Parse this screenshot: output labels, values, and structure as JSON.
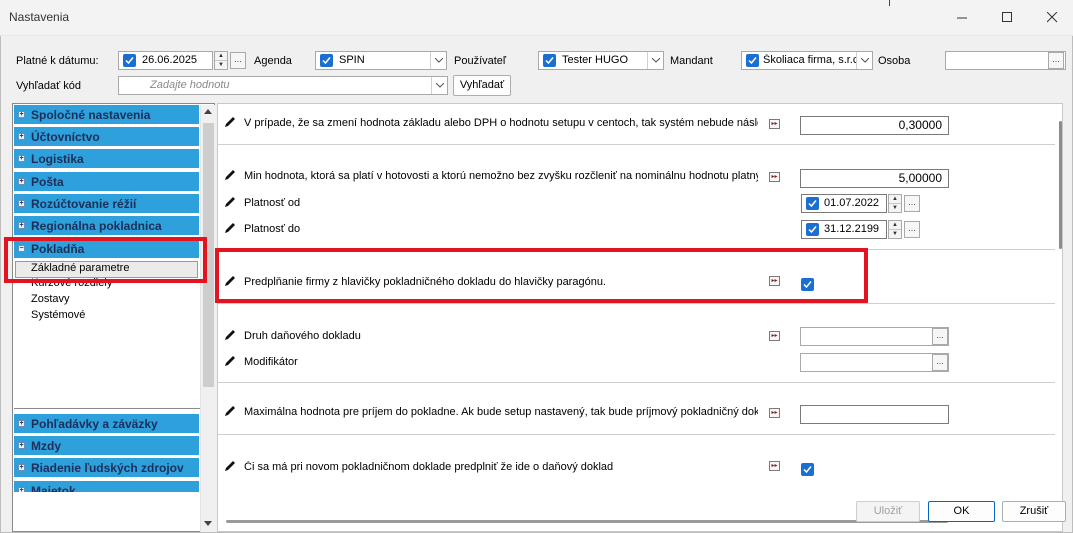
{
  "window": {
    "title": "Nastavenia"
  },
  "filters": {
    "date_label": "Platné k dátumu:",
    "date_value": "26.06.2025",
    "agenda_label": "Agenda",
    "agenda_value": "SPIN",
    "user_label": "Používateľ",
    "user_value": "Tester HUGO",
    "mandant_label": "Mandant",
    "mandant_value": "Školiaca firma, s.r.c",
    "osoba_label": "Osoba",
    "osoba_value": "",
    "search_label": "Vyhľadať kód",
    "search_placeholder": "Zadajte hodnotu",
    "search_button": "Vyhľadať",
    "ellipsis": "..."
  },
  "sidebar": {
    "categories_top": [
      "Spoločné nastavenia",
      "Účtovníctvo",
      "Logistika",
      "Pošta",
      "Rozúčtovanie réžií",
      "Regionálna pokladnica"
    ],
    "active_category": "Pokladňa",
    "subitems": [
      "Základné parametre",
      "Kurzové rozdiely",
      "Zostavy",
      "Systémové"
    ],
    "selected_subitem": "Základné parametre",
    "categories_bottom": [
      "Pohľadávky a záväzky",
      "Mzdy",
      "Riadenie ľudských zdrojov",
      "Majetok"
    ]
  },
  "settings": {
    "s1_text": "V prípade, že sa zmení hodnota základu alebo DPH o hodnotu setupu v centoch, tak systém nebude následne",
    "s1_value": "0,30000",
    "s2_text": "Min hodnota, ktorá sa platí v hotovosti a ktorú nemožno bez zvyšku rozčleniť na nominálnu hodnotu platných m",
    "s2_value": "5,00000",
    "valid_from_label": "Platnosť od",
    "valid_from_value": "01.07.2022",
    "valid_to_label": "Platnosť do",
    "valid_to_value": "31.12.2199",
    "s3_text": "Predpĺňanie firmy z hlavičky pokladničného dokladu do hlavičky paragónu.",
    "s3_checked": true,
    "s4_text": "Druh daňového dokladu",
    "s4_value": "",
    "s5_text": "Modifikátor",
    "s5_value": "",
    "s6_text": "Maximálna hodnota pre príjem do pokladne. Ak bude setup nastavený, tak bude príjmový pokladničný doklad k",
    "s6_value": "",
    "s7_text": "Či sa má pri novom pokladničnom doklade predplniť že ide o daňový doklad",
    "s7_checked": true,
    "action_glyph": "▸▸"
  },
  "footer": {
    "save": "Uložiť",
    "ok": "OK",
    "cancel": "Zrušiť"
  },
  "colors": {
    "category_bg": "#2ea0db",
    "highlight": "#e2141f",
    "checkbox": "#1a6fd1"
  }
}
